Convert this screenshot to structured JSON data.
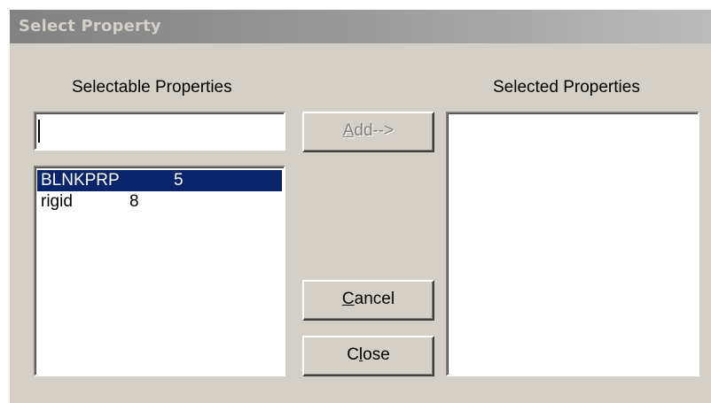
{
  "window": {
    "title": "Select Property"
  },
  "left_panel": {
    "label": "Selectable Properties",
    "search_value": "",
    "items": [
      {
        "name": "BLNKPRP",
        "count": "5",
        "selected": true
      },
      {
        "name": "rigid",
        "count": "8",
        "selected": false
      }
    ]
  },
  "right_panel": {
    "label": "Selected Properties",
    "items": []
  },
  "buttons": {
    "add": {
      "mnemonic": "A",
      "rest": "dd-->",
      "enabled": false
    },
    "cancel": {
      "mnemonic": "C",
      "rest": "ancel",
      "enabled": true
    },
    "close": {
      "pre": "C",
      "mnemonic": "l",
      "rest": "ose",
      "enabled": true
    }
  },
  "colors": {
    "dialog_bg": "#d4d0c8",
    "selection_bg": "#0a246a",
    "selection_fg": "#ffffff",
    "disabled_text": "#808080",
    "titlebar_inactive_start": "#818181",
    "titlebar_inactive_end": "#bcbcbc"
  }
}
